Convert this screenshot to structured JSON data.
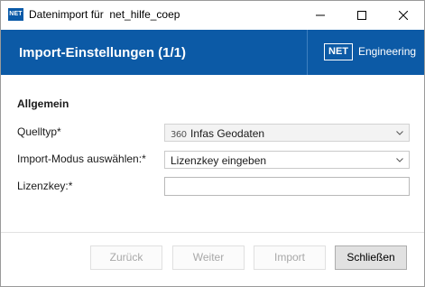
{
  "window": {
    "title": "Datenimport für  net_hilfe_coep",
    "app_icon_text": "NET"
  },
  "header": {
    "title": "Import-Einstellungen (1/1)",
    "brand_badge": "NET",
    "brand_text": "Engineering",
    "background_color": "#0c5aa6"
  },
  "section": {
    "title": "Allgemein"
  },
  "fields": {
    "quelltyp": {
      "label": "Quelltyp*",
      "icon_text": "360",
      "value": "Infas Geodaten"
    },
    "import_modus": {
      "label": "Import-Modus auswählen:*",
      "value": "Lizenzkey eingeben"
    },
    "lizenzkey": {
      "label": "Lizenzkey:*",
      "value": ""
    }
  },
  "buttons": {
    "back": "Zurück",
    "next": "Weiter",
    "import": "Import",
    "close": "Schließen"
  },
  "icons": {
    "minimize": "minimize-icon",
    "maximize": "maximize-icon",
    "close": "close-icon",
    "chevron": "chevron-down-icon"
  }
}
